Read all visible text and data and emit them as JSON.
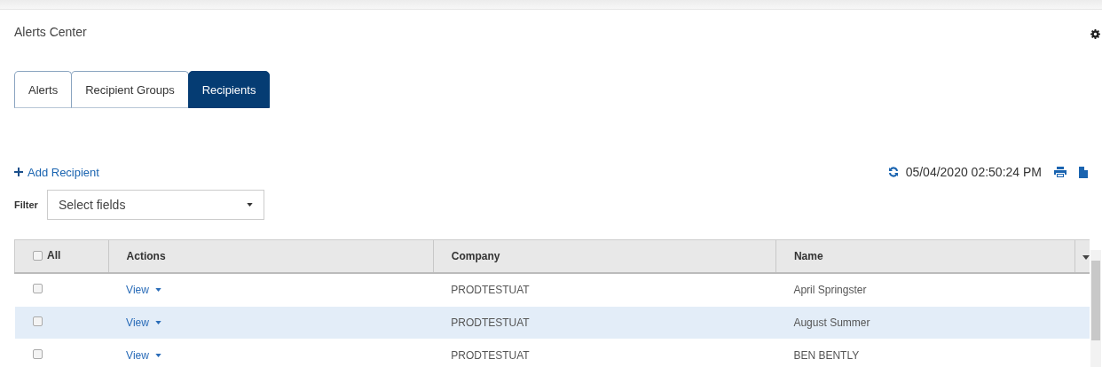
{
  "page": {
    "title": "Alerts Center"
  },
  "tabs": [
    {
      "label": "Alerts",
      "selected": false
    },
    {
      "label": "Recipient Groups",
      "selected": false
    },
    {
      "label": "Recipients",
      "selected": true
    }
  ],
  "toolbar": {
    "add_label": "Add Recipient",
    "timestamp": "05/04/2020 02:50:24 PM"
  },
  "filter": {
    "label": "Filter",
    "placeholder": "Select fields"
  },
  "table": {
    "select_all": {
      "label": "All",
      "checked": false
    },
    "columns": [
      "Actions",
      "Company",
      "Name"
    ],
    "rows": [
      {
        "checked": false,
        "selected": false,
        "action": "View",
        "company": "PRODTESTUAT",
        "name": "April Springster"
      },
      {
        "checked": false,
        "selected": true,
        "action": "View",
        "company": "PRODTESTUAT",
        "name": "August Summer"
      },
      {
        "checked": false,
        "selected": false,
        "action": "View",
        "company": "PRODTESTUAT",
        "name": "BEN BENTLY"
      }
    ]
  }
}
